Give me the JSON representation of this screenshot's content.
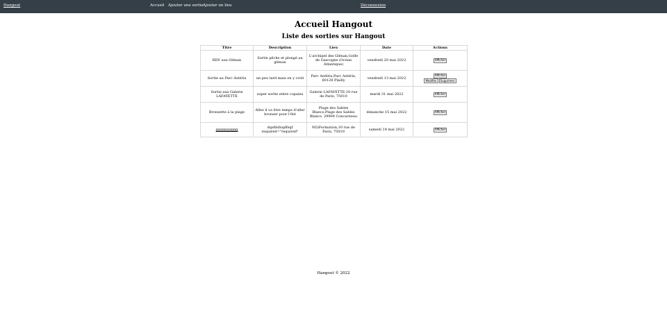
{
  "navbar": {
    "brand": "Hangout",
    "links": [
      "Accueil",
      "Ajouter une sortie",
      "Ajouter un lieu"
    ],
    "logout": "Déconnexion"
  },
  "page": {
    "title": "Accueil Hangout",
    "subtitle": "Liste des sorties sur Hangout"
  },
  "table": {
    "headers": [
      "Titre",
      "Description",
      "Lieu",
      "Date",
      "Actions"
    ],
    "rows": [
      {
        "titre": "RDV aux Glénan",
        "description": "Sortie pêche et plongé au glénan",
        "lieu": "L'archipel des Glénan,Golfe de Gascogne (Océan Atlantique)",
        "date": "vendredi 20 mai 2022",
        "actions": [
          "Afficher"
        ]
      },
      {
        "titre": "Sortie au Parc Astérix",
        "description": "un peu tard mais on y croit",
        "lieu": "Parc Astérix,Parc Astérix, 60128 Plailly",
        "date": "vendredi 13 mai 2022",
        "actions": [
          "Afficher",
          "Modifier",
          "Supprimer"
        ]
      },
      {
        "titre": "Sortie aux Galerie LAFAYETTE",
        "description": "super sortie entre copains",
        "lieu": "Galerie LAFAYETTE,10 rue de Paris, 75010",
        "date": "mardi 31 mai 2022",
        "actions": [
          "Afficher"
        ]
      },
      {
        "titre": "Bronzette à la plage",
        "description": "Allez il va être temps d'aller bronzer pour l'été",
        "lieu": "Plage des Sables Blancs,Plage des Sables Blancs, 29900 Concarneau",
        "date": "dimanche 15 mai 2022",
        "actions": [
          "Afficher"
        ]
      },
      {
        "titre": "gggggggggg",
        "description": "dqsfdsfsqdfsqf required=\"required\"",
        "lieu": "M2iFormation,10 rue de Paris, 75010",
        "date": "samedi 14 mai 2022",
        "actions": [
          "Afficher"
        ]
      }
    ]
  },
  "footer": "Hangout © 2022"
}
